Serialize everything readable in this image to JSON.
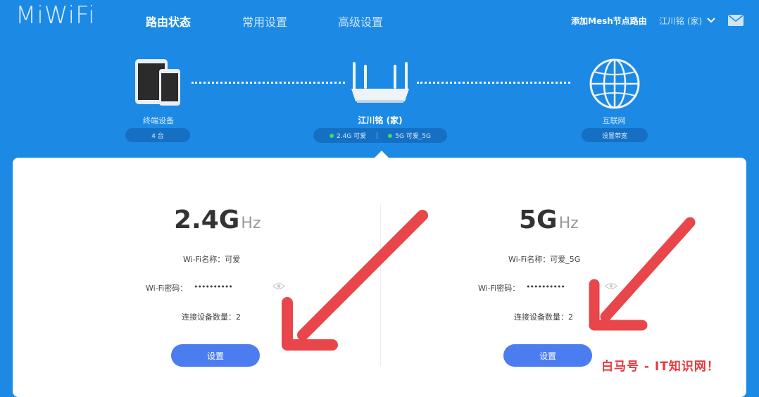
{
  "header": {
    "logo": "MiWiFi",
    "tabs": [
      "路由状态",
      "常用设置",
      "高级设置"
    ],
    "mesh_link": "添加Mesh节点路由",
    "user_label": "江川铭 (家)"
  },
  "topology": {
    "devices": {
      "label": "终端设备",
      "count": "4 台"
    },
    "router": {
      "name": "江川铭 (家)",
      "band_24": "2.4G 可爱",
      "band_5": "5G 可爱_5G"
    },
    "internet": {
      "label": "互联网",
      "action": "设置带宽"
    }
  },
  "wifi_24": {
    "freq": "2.4G",
    "unit": "Hz",
    "name_line": "Wi-Fi名称：可爱",
    "password_label": "Wi-Fi密码：",
    "password_mask": "••••••••••",
    "devices_line": "连接设备数量：2",
    "button": "设置"
  },
  "wifi_5": {
    "freq": "5G",
    "unit": "Hz",
    "name_line": "Wi-Fi名称：可爱_5G",
    "password_label": "Wi-Fi密码：",
    "password_mask": "••••••••••",
    "devices_line": "连接设备数量：2",
    "button": "设置"
  },
  "watermark": "白马号 - IT知识网！",
  "colors": {
    "background": "#1c8ae4",
    "button": "#4c7df0",
    "arrow": "#e8464a",
    "status_dot": "#40d67a"
  }
}
